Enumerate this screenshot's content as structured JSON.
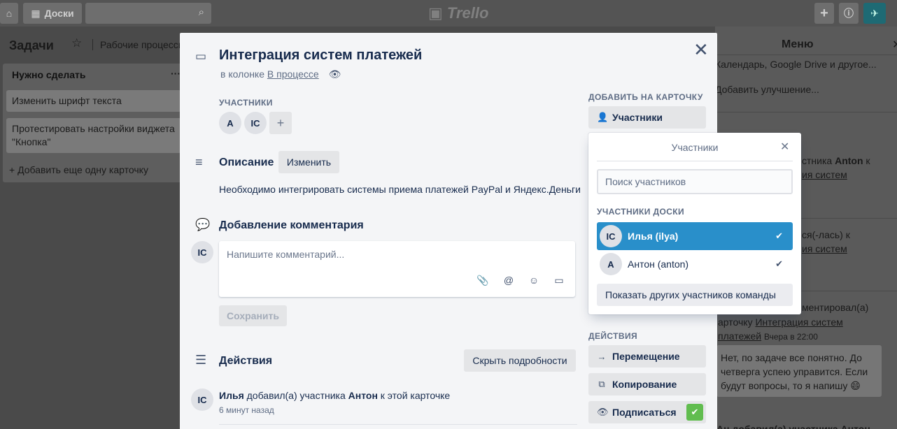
{
  "topbar": {
    "boards_label": "Доски",
    "logo_text": "Trello"
  },
  "board": {
    "title": "Задачи",
    "workflow_label": "Рабочие процессы"
  },
  "list": {
    "title": "Нужно сделать",
    "menu": "···",
    "cards": [
      "Изменить шрифт текста",
      "Протестировать настройки виджета \"Кнопка\""
    ],
    "add_card": "Добавить еще одну карточку"
  },
  "side_menu": {
    "title": "Меню",
    "line1": "Календарь, Google Drive и другое...",
    "line2": "Добавить улучшение...",
    "act1_a": "стника ",
    "act1_user": "Anton",
    "act1_b": " к",
    "act1_link": "ия систем",
    "act2_a": "ся(-лась) к",
    "act2_link": "ия систем",
    "act3_a": "ментировал(а)",
    "act3_b": "арточку ",
    "act3_link1": "Интеграция систем",
    "act3_link2": "платежей",
    "act3_time": "Вчера в 22:00",
    "bubble": "Нет, по задаче все понятно. До четверга успею управится. Если будут вопросы, то я напишу 😄",
    "last_line": "Ан добавил(а) участника Антон"
  },
  "card": {
    "title": "Интеграция систем платежей",
    "in_column_prefix": "в колонке",
    "column_link": "В процессе",
    "members_label": "Участники",
    "members": [
      "A",
      "IC"
    ],
    "description_title": "Описание",
    "edit_button": "Изменить",
    "description_text": "Необходимо интегрировать системы приема платежей PayPal и Яндекс.Деньги",
    "comment_title": "Добавление комментария",
    "current_user_initials": "IC",
    "comment_placeholder": "Напишите комментарий...",
    "save_button": "Сохранить",
    "activity_title": "Действия",
    "hide_details": "Скрыть подробности",
    "activity": {
      "user_initials": "IC",
      "user": "Илья",
      "action": " добавил(а) участника ",
      "target": "Антон",
      "suffix": " к этой карточке",
      "time": "6 минут назад"
    },
    "sidebar": {
      "add_label": "Добавить на карточку",
      "members_button": "Участники",
      "actions_label": "Действия",
      "move_button": "Перемещение",
      "copy_button": "Копирование",
      "subscribe_button": "Подписаться"
    }
  },
  "popover": {
    "title": "Участники",
    "search_placeholder": "Поиск участников",
    "section_label": "Участники доски",
    "members": [
      {
        "initials": "IC",
        "name": "Илья (ilya)",
        "selected": true
      },
      {
        "initials": "A",
        "name": "Антон (anton)",
        "selected": false
      }
    ],
    "show_others": "Показать других участников команды"
  },
  "colors": {
    "accent_blue": "#298fca",
    "green": "#61bd4f",
    "text": "#172b4d"
  }
}
